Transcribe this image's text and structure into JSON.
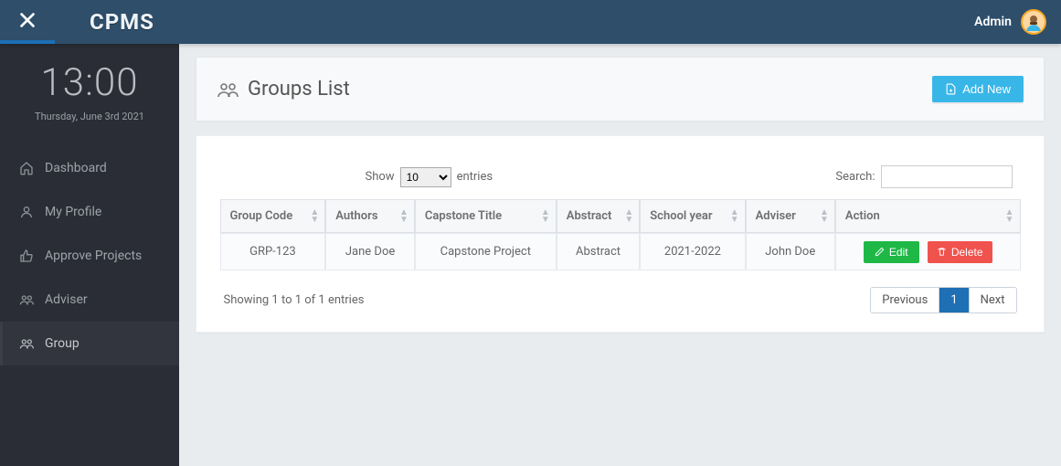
{
  "topbar": {
    "brand": "CPMS",
    "admin_label": "Admin"
  },
  "sidebar": {
    "clock": "13:00",
    "date": "Thursday, June 3rd 2021",
    "items": [
      {
        "label": "Dashboard"
      },
      {
        "label": "My Profile"
      },
      {
        "label": "Approve Projects"
      },
      {
        "label": "Adviser"
      },
      {
        "label": "Group"
      }
    ]
  },
  "page": {
    "title": "Groups List",
    "add_button": "Add New"
  },
  "table_controls": {
    "show_prefix": "Show",
    "show_value": "10",
    "show_suffix": "entries",
    "search_label": "Search:"
  },
  "table": {
    "headers": [
      "Group Code",
      "Authors",
      "Capstone Title",
      "Abstract",
      "School year",
      "Adviser",
      "Action"
    ],
    "rows": [
      {
        "code": "GRP-123",
        "authors": "Jane Doe",
        "title": "Capstone Project",
        "abstract": "Abstract",
        "year": "2021-2022",
        "adviser": "John Doe"
      }
    ],
    "edit_label": "Edit",
    "delete_label": "Delete"
  },
  "footer": {
    "info": "Showing 1 to 1 of 1 entries",
    "prev": "Previous",
    "page": "1",
    "next": "Next"
  }
}
